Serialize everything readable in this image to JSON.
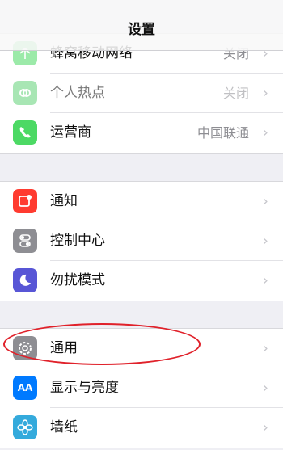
{
  "nav": {
    "title": "设置"
  },
  "section1": [
    {
      "label": "蜂窝移动网络",
      "value": "关闭",
      "icon": "antenna-icon",
      "color": "#4cd964",
      "dim": true
    },
    {
      "label": "个人热点",
      "value": "关闭",
      "icon": "hotspot-icon",
      "color": "#4cd964",
      "dim": true
    },
    {
      "label": "运营商",
      "value": "中国联通",
      "icon": "phone-icon",
      "color": "#4cd964",
      "dim": false
    }
  ],
  "section2": [
    {
      "label": "通知",
      "icon": "notification-icon",
      "color": "#ff3b30"
    },
    {
      "label": "控制中心",
      "icon": "toggle-icon",
      "color": "#8e8e93"
    },
    {
      "label": "勿扰模式",
      "icon": "moon-icon",
      "color": "#5856d6"
    }
  ],
  "section3": [
    {
      "label": "通用",
      "icon": "gear-icon",
      "color": "#8e8e93"
    },
    {
      "label": "显示与亮度",
      "icon": "text-size-icon",
      "color": "#007aff",
      "glyph": "AA"
    },
    {
      "label": "墙纸",
      "icon": "flower-icon",
      "color": "#34aadc"
    }
  ],
  "chevron": "›",
  "highlight_color": "#e0212a"
}
